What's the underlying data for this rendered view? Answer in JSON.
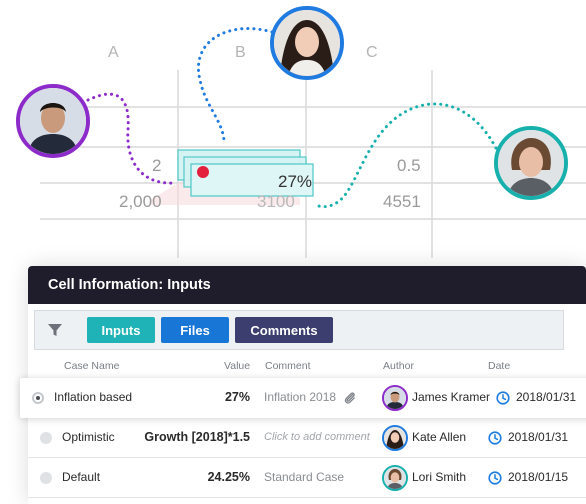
{
  "sheet": {
    "columns": [
      "A",
      "B",
      "C"
    ],
    "cells": {
      "r1_a": "2",
      "r1_c": "0.5",
      "r2_a": "2,000",
      "r2_b": "3100",
      "r2_c": "4551",
      "highlight_value": "27%"
    }
  },
  "panel": {
    "title": "Cell Information: Inputs",
    "tabs": [
      {
        "label": "Inputs",
        "color": "#1fb2b6"
      },
      {
        "label": "Files",
        "color": "#1877d6"
      },
      {
        "label": "Comments",
        "color": "#3b3e6e"
      }
    ],
    "columns": {
      "case_name": "Case Name",
      "value": "Value",
      "comment": "Comment",
      "author": "Author",
      "date": "Date"
    },
    "rows": [
      {
        "case": "Inflation based",
        "value": "27%",
        "comment": "Inflation 2018",
        "author": "James Kramer",
        "date": "2018/01/31",
        "selected": true
      },
      {
        "case": "Optimistic",
        "value": "Growth [2018]*1.5",
        "comment": "Click to add comment",
        "author": "Kate Allen",
        "date": "2018/01/31",
        "selected": false
      },
      {
        "case": "Default",
        "value": "24.25%",
        "comment": "Standard Case",
        "author": "Lori Smith",
        "date": "2018/01/15",
        "selected": false
      }
    ]
  },
  "colors": {
    "purple": "#8c2bc9",
    "blue": "#1f7be0",
    "teal": "#18b0ad",
    "header_bg": "#1f1d2b"
  },
  "icons": [
    "filter-icon",
    "paperclip-icon",
    "clock-icon",
    "radio-icon"
  ]
}
